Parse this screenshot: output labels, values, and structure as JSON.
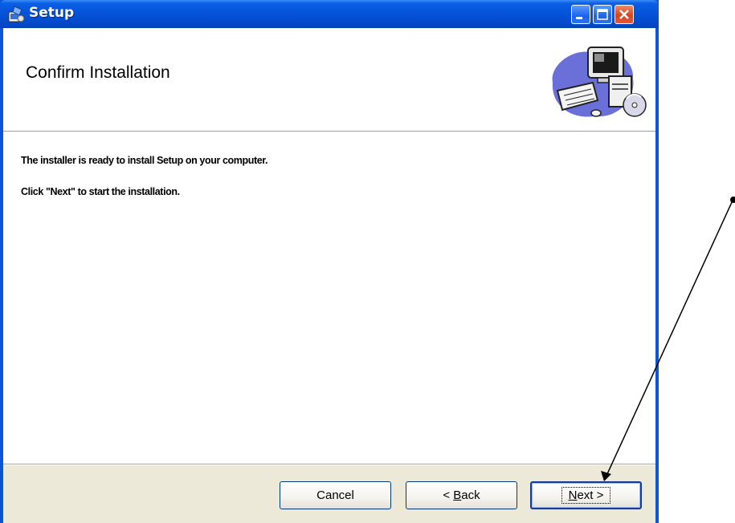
{
  "window": {
    "title": "Setup"
  },
  "header": {
    "title": "Confirm Installation",
    "graphic_icon": "computer-cd-icon"
  },
  "body": {
    "line1": "The installer is ready to install Setup on your computer.",
    "line2": "Click \"Next\" to start the installation."
  },
  "buttons": {
    "cancel": "Cancel",
    "back_prefix": "< ",
    "back_key": "B",
    "back_rest": "ack",
    "next_key": "N",
    "next_rest": "ext >"
  },
  "titlebar_buttons": [
    "minimize-icon",
    "maximize-icon",
    "close-icon"
  ],
  "colors": {
    "titlebar": "#0552d8",
    "client": "#ece9d8",
    "close_button": "#d8441e"
  }
}
